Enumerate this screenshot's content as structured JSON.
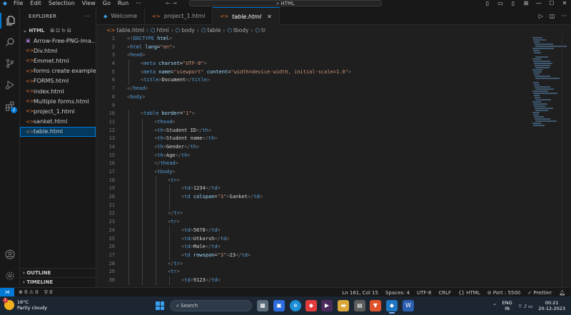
{
  "menu": [
    "File",
    "Edit",
    "Selection",
    "View",
    "Go",
    "Run",
    "···"
  ],
  "command_center": "HTML",
  "nav_arrows": "←  →",
  "sidebar": {
    "title": "EXPLORER",
    "more": "···",
    "folder": "HTML",
    "folder_tools": "⊞⊡↻⊟",
    "files": [
      {
        "name": "Arrow-Free-PNG-Ima...",
        "kind": "image"
      },
      {
        "name": "Div.html",
        "kind": "html"
      },
      {
        "name": "Emmet.html",
        "kind": "html"
      },
      {
        "name": "forms create example...",
        "kind": "html"
      },
      {
        "name": "FORMS.html",
        "kind": "html"
      },
      {
        "name": "index.html",
        "kind": "html"
      },
      {
        "name": "Multiple forms.html",
        "kind": "html"
      },
      {
        "name": "project_1.html",
        "kind": "html"
      },
      {
        "name": "sanket.html",
        "kind": "html"
      },
      {
        "name": "table.html",
        "kind": "html",
        "selected": true
      }
    ],
    "outline": "OUTLINE",
    "timeline": "TIMELINE"
  },
  "tabs": [
    {
      "label": "Welcome",
      "icon": "vscode-logo-icon"
    },
    {
      "label": "project_1.html",
      "icon": "html-file-icon"
    },
    {
      "label": "table.html",
      "icon": "html-file-icon",
      "active": true,
      "close": "✕"
    }
  ],
  "breadcrumb": [
    "table.html",
    "html",
    "body",
    "table",
    "tbody",
    "tr"
  ],
  "editor": {
    "line_numbers": [
      "1",
      "2",
      "3",
      "4",
      "5",
      "6",
      "7",
      "8",
      "9",
      "10",
      "11",
      "12",
      "13",
      "14",
      "15",
      "16",
      "17",
      "18",
      "19",
      "20",
      "21",
      "22",
      "23",
      "24",
      "25",
      "26",
      "27",
      "28",
      "29",
      "30"
    ],
    "lines": [
      {
        "indent": 0,
        "tokens": [
          [
            "br",
            "<!"
          ],
          [
            "tag",
            "DOCTYPE"
          ],
          [
            "txt",
            " "
          ],
          [
            "attr",
            "html"
          ],
          [
            "br",
            ">"
          ]
        ]
      },
      {
        "indent": 0,
        "tokens": [
          [
            "br",
            "<"
          ],
          [
            "tag",
            "html"
          ],
          [
            "txt",
            " "
          ],
          [
            "attr",
            "lang"
          ],
          [
            "eq",
            "="
          ],
          [
            "str",
            "\"en\""
          ],
          [
            "br",
            ">"
          ]
        ]
      },
      {
        "indent": 0,
        "tokens": [
          [
            "br",
            "<"
          ],
          [
            "tag",
            "head"
          ],
          [
            "br",
            ">"
          ]
        ]
      },
      {
        "indent": 1,
        "tokens": [
          [
            "br",
            "<"
          ],
          [
            "tag",
            "meta"
          ],
          [
            "txt",
            " "
          ],
          [
            "attr",
            "charset"
          ],
          [
            "eq",
            "="
          ],
          [
            "str",
            "\"UTF-8\""
          ],
          [
            "br",
            ">"
          ]
        ]
      },
      {
        "indent": 1,
        "tokens": [
          [
            "br",
            "<"
          ],
          [
            "tag",
            "meta"
          ],
          [
            "txt",
            " "
          ],
          [
            "attr",
            "name"
          ],
          [
            "eq",
            "="
          ],
          [
            "str",
            "\"viewport\""
          ],
          [
            "txt",
            " "
          ],
          [
            "attr",
            "content"
          ],
          [
            "eq",
            "="
          ],
          [
            "str",
            "\"width=device-width, initial-scale=1.0\""
          ],
          [
            "br",
            ">"
          ]
        ]
      },
      {
        "indent": 1,
        "tokens": [
          [
            "br",
            "<"
          ],
          [
            "tag",
            "title"
          ],
          [
            "br",
            ">"
          ],
          [
            "txt",
            "Document"
          ],
          [
            "br",
            "</"
          ],
          [
            "tag",
            "title"
          ],
          [
            "br",
            ">"
          ]
        ]
      },
      {
        "indent": 0,
        "tokens": [
          [
            "br",
            "</"
          ],
          [
            "tag",
            "head"
          ],
          [
            "br",
            ">"
          ]
        ]
      },
      {
        "indent": 0,
        "tokens": [
          [
            "br",
            "<"
          ],
          [
            "tag",
            "body"
          ],
          [
            "br",
            ">"
          ]
        ]
      },
      {
        "indent": 0,
        "tokens": []
      },
      {
        "indent": 1,
        "tokens": [
          [
            "br",
            "<"
          ],
          [
            "tag",
            "table"
          ],
          [
            "txt",
            " "
          ],
          [
            "attr",
            "border"
          ],
          [
            "eq",
            "="
          ],
          [
            "str",
            "\"1\""
          ],
          [
            "br",
            ">"
          ]
        ]
      },
      {
        "indent": 2,
        "tokens": [
          [
            "br",
            "<"
          ],
          [
            "tag",
            "thead"
          ],
          [
            "br",
            ">"
          ]
        ]
      },
      {
        "indent": 2,
        "tokens": [
          [
            "br",
            "<"
          ],
          [
            "tag",
            "th"
          ],
          [
            "br",
            ">"
          ],
          [
            "txt",
            "Student ID"
          ],
          [
            "br",
            "</"
          ],
          [
            "tag",
            "th"
          ],
          [
            "br",
            ">"
          ]
        ]
      },
      {
        "indent": 2,
        "tokens": [
          [
            "br",
            "<"
          ],
          [
            "tag",
            "th"
          ],
          [
            "br",
            ">"
          ],
          [
            "txt",
            "Student name"
          ],
          [
            "br",
            "</"
          ],
          [
            "tag",
            "th"
          ],
          [
            "br",
            ">"
          ]
        ]
      },
      {
        "indent": 2,
        "tokens": [
          [
            "br",
            "<"
          ],
          [
            "tag",
            "th"
          ],
          [
            "br",
            ">"
          ],
          [
            "txt",
            "Gender"
          ],
          [
            "br",
            "</"
          ],
          [
            "tag",
            "th"
          ],
          [
            "br",
            ">"
          ]
        ]
      },
      {
        "indent": 2,
        "tokens": [
          [
            "br",
            "<"
          ],
          [
            "tag",
            "th"
          ],
          [
            "br",
            ">"
          ],
          [
            "txt",
            "Age"
          ],
          [
            "br",
            "</"
          ],
          [
            "tag",
            "th"
          ],
          [
            "br",
            ">"
          ]
        ]
      },
      {
        "indent": 2,
        "tokens": [
          [
            "br",
            "</"
          ],
          [
            "tag",
            "thead"
          ],
          [
            "br",
            ">"
          ]
        ]
      },
      {
        "indent": 2,
        "tokens": [
          [
            "br",
            "<"
          ],
          [
            "tag",
            "tbody"
          ],
          [
            "br",
            ">"
          ]
        ]
      },
      {
        "indent": 3,
        "tokens": [
          [
            "br",
            "<"
          ],
          [
            "tag",
            "tr"
          ],
          [
            "br",
            ">"
          ]
        ]
      },
      {
        "indent": 4,
        "tokens": [
          [
            "br",
            "<"
          ],
          [
            "tag",
            "td"
          ],
          [
            "br",
            ">"
          ],
          [
            "txt",
            "1234"
          ],
          [
            "br",
            "</"
          ],
          [
            "tag",
            "td"
          ],
          [
            "br",
            ">"
          ]
        ]
      },
      {
        "indent": 4,
        "tokens": [
          [
            "br",
            "<"
          ],
          [
            "tag",
            "td"
          ],
          [
            "txt",
            " "
          ],
          [
            "attr",
            "colspan"
          ],
          [
            "eq",
            "="
          ],
          [
            "str",
            "\"3\""
          ],
          [
            "br",
            ">"
          ],
          [
            "txt",
            "Sanket"
          ],
          [
            "br",
            "</"
          ],
          [
            "tag",
            "td"
          ],
          [
            "br",
            ">"
          ]
        ]
      },
      {
        "indent": 4,
        "tokens": []
      },
      {
        "indent": 3,
        "tokens": [
          [
            "br",
            "</"
          ],
          [
            "tag",
            "tr"
          ],
          [
            "br",
            ">"
          ]
        ]
      },
      {
        "indent": 3,
        "tokens": [
          [
            "br",
            "<"
          ],
          [
            "tag",
            "tr"
          ],
          [
            "br",
            ">"
          ]
        ]
      },
      {
        "indent": 4,
        "tokens": [
          [
            "br",
            "<"
          ],
          [
            "tag",
            "td"
          ],
          [
            "br",
            ">"
          ],
          [
            "txt",
            "5678"
          ],
          [
            "br",
            "</"
          ],
          [
            "tag",
            "td"
          ],
          [
            "br",
            ">"
          ]
        ]
      },
      {
        "indent": 4,
        "tokens": [
          [
            "br",
            "<"
          ],
          [
            "tag",
            "td"
          ],
          [
            "br",
            ">"
          ],
          [
            "txt",
            "Utkarsh"
          ],
          [
            "br",
            "</"
          ],
          [
            "tag",
            "td"
          ],
          [
            "br",
            ">"
          ]
        ]
      },
      {
        "indent": 4,
        "tokens": [
          [
            "br",
            "<"
          ],
          [
            "tag",
            "td"
          ],
          [
            "br",
            ">"
          ],
          [
            "txt",
            "Male"
          ],
          [
            "br",
            "</"
          ],
          [
            "tag",
            "td"
          ],
          [
            "br",
            ">"
          ]
        ]
      },
      {
        "indent": 4,
        "tokens": [
          [
            "br",
            "<"
          ],
          [
            "tag",
            "td"
          ],
          [
            "txt",
            " "
          ],
          [
            "attr",
            "rowspan"
          ],
          [
            "eq",
            "="
          ],
          [
            "str",
            "\"3\""
          ],
          [
            "br",
            ">"
          ],
          [
            "txt",
            "23"
          ],
          [
            "br",
            "</"
          ],
          [
            "tag",
            "td"
          ],
          [
            "br",
            ">"
          ]
        ]
      },
      {
        "indent": 3,
        "tokens": [
          [
            "br",
            "</"
          ],
          [
            "tag",
            "tr"
          ],
          [
            "br",
            ">"
          ]
        ]
      },
      {
        "indent": 3,
        "tokens": [
          [
            "br",
            "<"
          ],
          [
            "tag",
            "tr"
          ],
          [
            "br",
            ">"
          ]
        ]
      },
      {
        "indent": 4,
        "tokens": [
          [
            "br",
            "<"
          ],
          [
            "tag",
            "td"
          ],
          [
            "br",
            ">"
          ],
          [
            "txt",
            "9123"
          ],
          [
            "br",
            "</"
          ],
          [
            "tag",
            "td"
          ],
          [
            "br",
            ">"
          ]
        ]
      }
    ]
  },
  "statusbar": {
    "problems": "⊗ 0 ⚠ 0",
    "ports_count": "⚲ 0",
    "position": "Ln 161, Col 15",
    "spaces": "Spaces: 4",
    "encoding": "UTF-8",
    "eol": "CRLF",
    "language": "{} HTML",
    "port": "Port : 5500",
    "prettier": "✓ Prettier"
  },
  "taskbar": {
    "temperature": "16°C",
    "weather": "Partly cloudy",
    "weather_badge": "1",
    "search_placeholder": "Search",
    "lang_top": "ENG",
    "lang_bottom": "IN",
    "time": "00:21",
    "date": "20-12-2023"
  },
  "colors": {
    "accent": "#0078d4",
    "tag": "#569cd6",
    "attribute": "#9cdcfe",
    "string": "#ce9178"
  }
}
